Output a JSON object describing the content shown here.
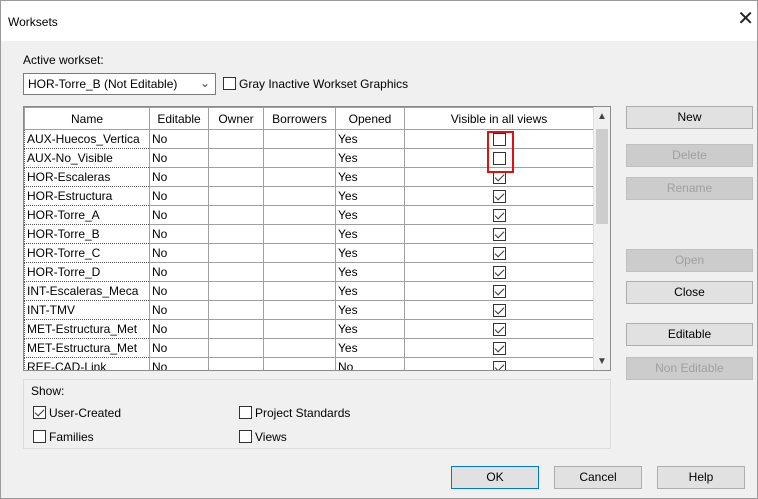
{
  "window": {
    "title": "Worksets",
    "close_glyph": "✕"
  },
  "active_workset": {
    "label": "Active workset:",
    "value": "HOR-Torre_B (Not Editable)",
    "gray_inactive_label": "Gray Inactive Workset Graphics",
    "gray_inactive_checked": false
  },
  "grid": {
    "columns": [
      "Name",
      "Editable",
      "Owner",
      "Borrowers",
      "Opened",
      "Visible in all views"
    ],
    "rows": [
      {
        "name": "AUX-Huecos_Vertica",
        "editable": "No",
        "owner": "",
        "borrowers": "",
        "opened": "Yes",
        "visible": false
      },
      {
        "name": "AUX-No_Visible",
        "editable": "No",
        "owner": "",
        "borrowers": "",
        "opened": "Yes",
        "visible": false
      },
      {
        "name": "HOR-Escaleras",
        "editable": "No",
        "owner": "",
        "borrowers": "",
        "opened": "Yes",
        "visible": true
      },
      {
        "name": "HOR-Estructura",
        "editable": "No",
        "owner": "",
        "borrowers": "",
        "opened": "Yes",
        "visible": true
      },
      {
        "name": "HOR-Torre_A",
        "editable": "No",
        "owner": "",
        "borrowers": "",
        "opened": "Yes",
        "visible": true
      },
      {
        "name": "HOR-Torre_B",
        "editable": "No",
        "owner": "",
        "borrowers": "",
        "opened": "Yes",
        "visible": true
      },
      {
        "name": "HOR-Torre_C",
        "editable": "No",
        "owner": "",
        "borrowers": "",
        "opened": "Yes",
        "visible": true
      },
      {
        "name": "HOR-Torre_D",
        "editable": "No",
        "owner": "",
        "borrowers": "",
        "opened": "Yes",
        "visible": true
      },
      {
        "name": "INT-Escaleras_Meca",
        "editable": "No",
        "owner": "",
        "borrowers": "",
        "opened": "Yes",
        "visible": true
      },
      {
        "name": "INT-TMV",
        "editable": "No",
        "owner": "",
        "borrowers": "",
        "opened": "Yes",
        "visible": true
      },
      {
        "name": "MET-Estructura_Met",
        "editable": "No",
        "owner": "",
        "borrowers": "",
        "opened": "Yes",
        "visible": true
      },
      {
        "name": "MET-Estructura_Met",
        "editable": "No",
        "owner": "",
        "borrowers": "",
        "opened": "Yes",
        "visible": true
      },
      {
        "name": "REF-CAD-Link",
        "editable": "No",
        "owner": "",
        "borrowers": "",
        "opened": "No",
        "visible": true
      }
    ]
  },
  "side_buttons": {
    "new": "New",
    "delete": "Delete",
    "rename": "Rename",
    "open": "Open",
    "close": "Close",
    "editable": "Editable",
    "non_editable": "Non Editable"
  },
  "show": {
    "label": "Show:",
    "user_created": {
      "label": "User-Created",
      "checked": true
    },
    "families": {
      "label": "Families",
      "checked": false
    },
    "project_standards": {
      "label": "Project Standards",
      "checked": false
    },
    "views": {
      "label": "Views",
      "checked": false
    }
  },
  "footer": {
    "ok": "OK",
    "cancel": "Cancel",
    "help": "Help"
  },
  "colors": {
    "highlight": "#e01010",
    "focus_border": "#0078d7"
  }
}
